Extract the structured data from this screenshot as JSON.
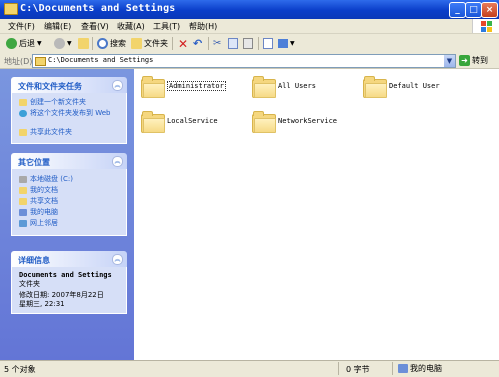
{
  "window": {
    "title": "C:\\Documents and Settings"
  },
  "menu": [
    "文件(F)",
    "编辑(E)",
    "查看(V)",
    "收藏(A)",
    "工具(T)",
    "帮助(H)"
  ],
  "toolbar": {
    "back": "后退",
    "search": "搜索",
    "folders": "文件夹"
  },
  "address": {
    "label": "地址(D)",
    "value": "C:\\Documents and Settings",
    "go": "转到"
  },
  "tasks_panel": {
    "title": "文件和文件夹任务",
    "items": [
      "创建一个新文件夹",
      "将这个文件夹发布到 Web",
      "共享此文件夹"
    ]
  },
  "other_places": {
    "title": "其它位置",
    "items": [
      "本地磁盘 (C:)",
      "我的文档",
      "共享文档",
      "我的电脑",
      "网上邻居"
    ]
  },
  "details": {
    "title": "详细信息",
    "name": "Documents and Settings",
    "type": "文件夹",
    "modified": "修改日期: 2007年8月22日星期三, 22:31"
  },
  "folders": [
    "Administrator",
    "All Users",
    "Default User",
    "LocalService",
    "NetworkService"
  ],
  "status": {
    "count": "5 个对象",
    "size": "0 字节",
    "location": "我的电脑"
  }
}
